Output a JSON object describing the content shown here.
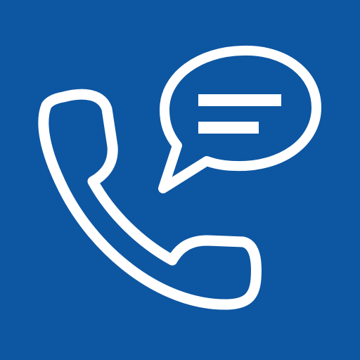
{
  "icon": {
    "name": "phone-message-icon",
    "background_color": "#0d56a2",
    "foreground_color": "#ffffff",
    "glyphs": [
      "phone-handset-icon",
      "speech-bubble-icon",
      "text-lines-icon"
    ]
  }
}
